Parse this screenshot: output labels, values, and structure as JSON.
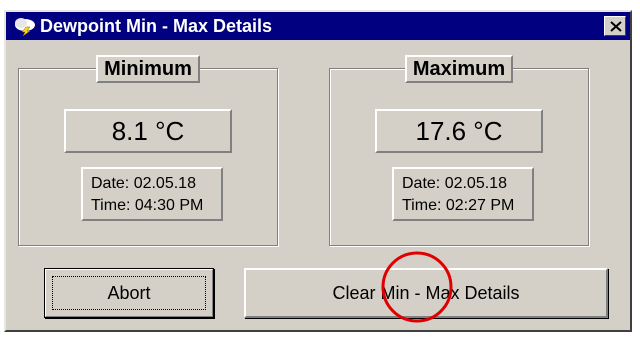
{
  "window": {
    "title": "Dewpoint Min - Max Details",
    "app_icon": "weather-cloud-lightning-icon",
    "close_icon": "close-icon"
  },
  "minimum": {
    "label": "Minimum",
    "value": "8.1 °C",
    "date": "Date: 02.05.18",
    "time": "Time: 04:30 PM"
  },
  "maximum": {
    "label": "Maximum",
    "value": "17.6 °C",
    "date": "Date: 02.05.18",
    "time": "Time: 02:27 PM"
  },
  "buttons": {
    "abort": "Abort",
    "clear": "Clear Min - Max Details"
  },
  "colors": {
    "titlebar": "#000080",
    "face": "#d4d0c8",
    "annotation": "#e00000"
  }
}
